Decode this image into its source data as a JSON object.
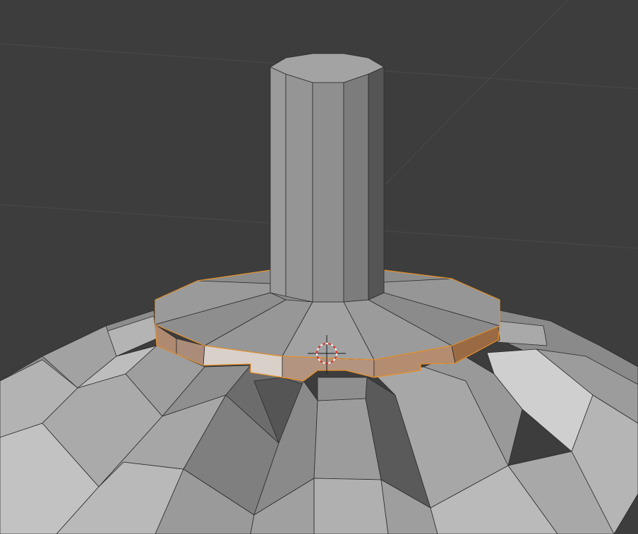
{
  "app": "3D Viewport",
  "viewport": {
    "background_color": "#3d3d3d",
    "grid_color": "#4a4a4a",
    "mesh_base_color": "#9a9a9a",
    "selection_color": "#e8922a",
    "selected_face_color": "#b08a70",
    "active_face_color": "#d9d0ca",
    "cursor_colors": [
      "#e8e8e8",
      "#d23a2a"
    ]
  },
  "objects": [
    {
      "name": "cylinder-post",
      "shape": "cylinder",
      "selected": false
    },
    {
      "name": "base-ring",
      "shape": "ring",
      "selected": true
    },
    {
      "name": "dome",
      "shape": "sphere",
      "selected": false
    }
  ],
  "icons": [
    "3d-cursor-icon"
  ]
}
